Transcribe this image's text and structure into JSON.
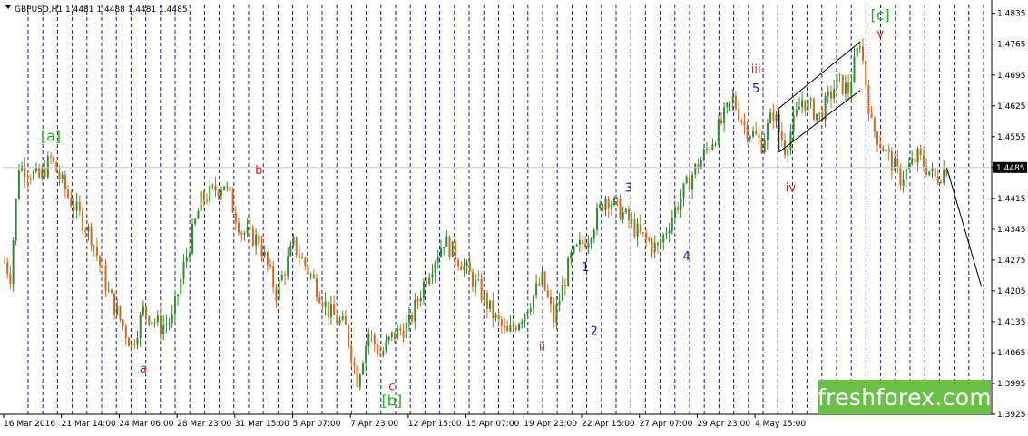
{
  "window": {
    "symbol_line": "GBPUSD,H1  1.4481 1.4488 1.4481 1.4485",
    "current_price": "1.4485"
  },
  "brand": {
    "text": "freshforex.com"
  },
  "colors": {
    "bull": "#2e8b2e",
    "bear": "#d2691e",
    "wave_red": "#e01c1c",
    "wave_green": "#22b422",
    "wave_blue": "#1a1aa0",
    "brand_bg": "#6cc04a",
    "grid": "#1e1e78"
  },
  "chart_data": {
    "type": "candlestick",
    "ylim": [
      1.3925,
      1.4855
    ],
    "y_ticks": [
      "1.4835",
      "1.4765",
      "1.4695",
      "1.4625",
      "1.4555",
      "1.4485",
      "1.4415",
      "1.4345",
      "1.4275",
      "1.4205",
      "1.4135",
      "1.4065",
      "1.3995",
      "1.3925"
    ],
    "x_ticks": [
      "16 Mar 2016",
      "21 Mar 14:00",
      "24 Mar 06:00",
      "28 Mar 23:00",
      "31 Mar 15:00",
      "5 Apr 07:00",
      "7 Apr 23:00",
      "12 Apr 15:00",
      "15 Apr 07:00",
      "19 Apr 23:00",
      "22 Apr 15:00",
      "27 Apr 07:00",
      "29 Apr 23:00",
      "4 May 15:00"
    ],
    "price_path": [
      [
        0,
        1.427
      ],
      [
        2,
        1.424
      ],
      [
        5,
        1.449
      ],
      [
        12,
        1.446
      ],
      [
        16,
        1.4505
      ],
      [
        22,
        1.442
      ],
      [
        30,
        1.433
      ],
      [
        36,
        1.42
      ],
      [
        44,
        1.408
      ],
      [
        48,
        1.416
      ],
      [
        54,
        1.4125
      ],
      [
        58,
        1.414
      ],
      [
        62,
        1.426
      ],
      [
        68,
        1.441
      ],
      [
        76,
        1.445
      ],
      [
        82,
        1.434
      ],
      [
        88,
        1.432
      ],
      [
        94,
        1.42
      ],
      [
        100,
        1.431
      ],
      [
        106,
        1.424
      ],
      [
        112,
        1.416
      ],
      [
        118,
        1.412
      ],
      [
        122,
        1.4005
      ],
      [
        126,
        1.411
      ],
      [
        130,
        1.406
      ],
      [
        134,
        1.41
      ],
      [
        140,
        1.413
      ],
      [
        146,
        1.424
      ],
      [
        152,
        1.432
      ],
      [
        158,
        1.427
      ],
      [
        164,
        1.421
      ],
      [
        170,
        1.414
      ],
      [
        174,
        1.4105
      ],
      [
        180,
        1.416
      ],
      [
        186,
        1.423
      ],
      [
        190,
        1.414
      ],
      [
        196,
        1.428
      ],
      [
        202,
        1.433
      ],
      [
        208,
        1.442
      ],
      [
        214,
        1.438
      ],
      [
        220,
        1.433
      ],
      [
        226,
        1.43
      ],
      [
        232,
        1.439
      ],
      [
        238,
        1.447
      ],
      [
        246,
        1.456
      ],
      [
        252,
        1.464
      ],
      [
        256,
        1.458
      ],
      [
        262,
        1.454
      ],
      [
        266,
        1.461
      ],
      [
        270,
        1.453
      ],
      [
        276,
        1.464
      ],
      [
        282,
        1.46
      ],
      [
        288,
        1.468
      ],
      [
        292,
        1.466
      ],
      [
        296,
        1.4775
      ],
      [
        300,
        1.458
      ],
      [
        304,
        1.453
      ],
      [
        310,
        1.446
      ],
      [
        316,
        1.451
      ],
      [
        322,
        1.446
      ],
      [
        326,
        1.4485
      ]
    ],
    "projection": {
      "from": [
        326,
        1.4485
      ],
      "to": [
        338,
        1.4215
      ]
    },
    "channel": {
      "upper": [
        [
          268,
          1.462
        ],
        [
          296,
          1.477
        ]
      ],
      "lower": [
        [
          268,
          1.452
        ],
        [
          296,
          1.466
        ]
      ]
    },
    "wave_labels": [
      {
        "text": "[a]",
        "color": "green",
        "bar": 16,
        "price": 1.4545
      },
      {
        "text": "a",
        "color": "red",
        "bar": 48,
        "price": 1.402
      },
      {
        "text": "b",
        "color": "red",
        "bar": 88,
        "price": 1.447
      },
      {
        "text": "c",
        "color": "red",
        "bar": 134,
        "price": 1.398
      },
      {
        "text": "[b]",
        "color": "green",
        "bar": 134,
        "price": 1.3945
      },
      {
        "text": "ii",
        "color": "red",
        "bar": 186,
        "price": 1.407
      },
      {
        "text": "1",
        "color": "blue",
        "bar": 201,
        "price": 1.425
      },
      {
        "text": "2",
        "color": "blue",
        "bar": 204,
        "price": 1.4105
      },
      {
        "text": "3",
        "color": "blue",
        "bar": 216,
        "price": 1.443
      },
      {
        "text": "4",
        "color": "blue",
        "bar": 236,
        "price": 1.4275
      },
      {
        "text": "5",
        "color": "blue",
        "bar": 260,
        "price": 1.4655
      },
      {
        "text": "iii",
        "color": "red",
        "bar": 260,
        "price": 1.47
      },
      {
        "text": "iv",
        "color": "red",
        "bar": 272,
        "price": 1.443
      },
      {
        "text": "v",
        "color": "red",
        "bar": 303,
        "price": 1.478
      },
      {
        "text": "[c]",
        "color": "green",
        "bar": 303,
        "price": 1.482
      }
    ]
  }
}
